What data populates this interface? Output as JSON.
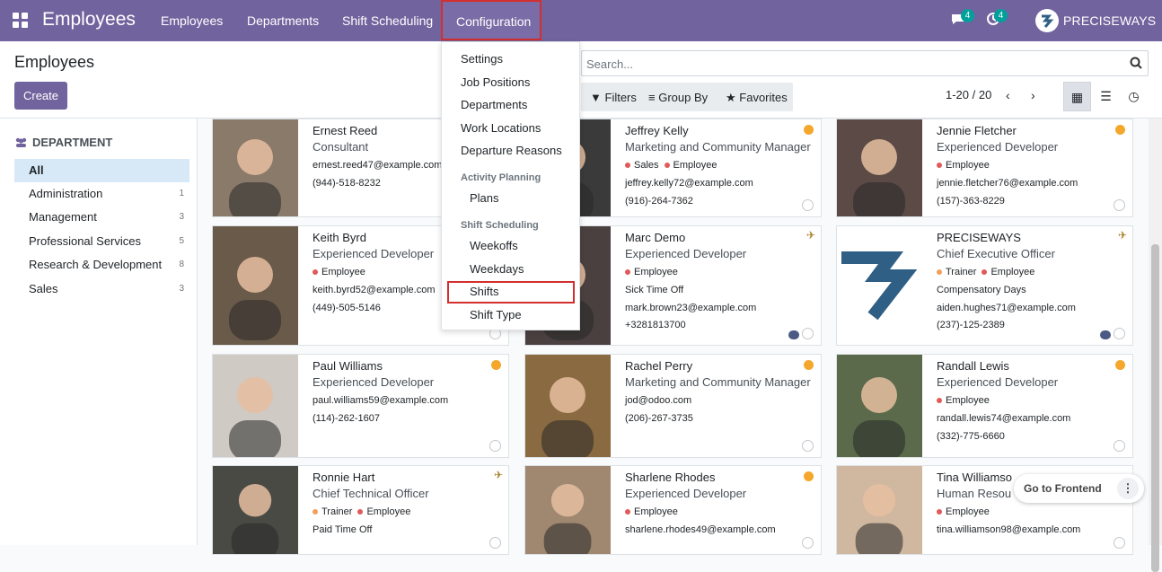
{
  "navbar": {
    "app_title": "Employees",
    "menu": [
      "Employees",
      "Departments",
      "Shift Scheduling"
    ],
    "active_menu": "Configuration",
    "messages_count": "4",
    "activities_count": "4",
    "company": "PRECISEWAYS"
  },
  "control_panel": {
    "breadcrumb": "Employees",
    "create_label": "Create",
    "search_placeholder": "Search...",
    "filters_label": "Filters",
    "group_by_label": "Group By",
    "favorites_label": "Favorites",
    "pager": "1-20 / 20"
  },
  "sidebar": {
    "heading": "DEPARTMENT",
    "items": [
      {
        "label": "All",
        "count": ""
      },
      {
        "label": "Administration",
        "count": "1"
      },
      {
        "label": "Management",
        "count": "3"
      },
      {
        "label": "Professional Services",
        "count": "5"
      },
      {
        "label": "Research & Development",
        "count": "8"
      },
      {
        "label": "Sales",
        "count": "3"
      }
    ]
  },
  "dropdown": {
    "items": [
      "Settings",
      "Job Positions",
      "Departments",
      "Work Locations",
      "Departure Reasons"
    ],
    "section1": "Activity Planning",
    "section1_items": [
      "Plans"
    ],
    "section2": "Shift Scheduling",
    "section2_items": [
      "Weekoffs",
      "Weekdays",
      "Shifts",
      "Shift Type"
    ]
  },
  "cards": [
    {
      "name": "Ernest Reed",
      "job": "Consultant",
      "tags": [],
      "lines": [
        "ernest.reed47@example.com",
        "(944)-518-8232",
        ""
      ]
    },
    {
      "name": "Jeffrey Kelly",
      "job": "Marketing and Community Manager",
      "tags": [
        "Sales",
        "Employee"
      ],
      "lines": [
        "jeffrey.kelly72@example.com",
        "(916)-264-7362",
        ""
      ]
    },
    {
      "name": "Jennie Fletcher",
      "job": "Experienced Developer",
      "tags": [
        "Employee"
      ],
      "lines": [
        "jennie.fletcher76@example.com",
        "(157)-363-8229",
        ""
      ]
    },
    {
      "name": "Keith Byrd",
      "job": "Experienced Developer",
      "tags": [
        "Employee"
      ],
      "lines": [
        "keith.byrd52@example.com",
        "(449)-505-5146",
        ""
      ]
    },
    {
      "name": "Marc Demo",
      "job": "Experienced Developer",
      "tags": [
        "Employee"
      ],
      "lines": [
        "Sick Time Off",
        "mark.brown23@example.com",
        "+3281813700"
      ]
    },
    {
      "name": "PRECISEWAYS",
      "job": "Chief Executive Officer",
      "tags": [
        "Trainer",
        "Employee"
      ],
      "lines": [
        "Compensatory Days",
        "aiden.hughes71@example.com",
        "(237)-125-2389"
      ]
    },
    {
      "name": "Paul Williams",
      "job": "Experienced Developer",
      "tags": [],
      "lines": [
        "paul.williams59@example.com",
        "(114)-262-1607",
        ""
      ]
    },
    {
      "name": "Rachel Perry",
      "job": "Marketing and Community Manager",
      "tags": [],
      "lines": [
        "jod@odoo.com",
        "(206)-267-3735",
        ""
      ]
    },
    {
      "name": "Randall Lewis",
      "job": "Experienced Developer",
      "tags": [
        "Employee"
      ],
      "lines": [
        "randall.lewis74@example.com",
        "(332)-775-6660",
        ""
      ]
    },
    {
      "name": "Ronnie Hart",
      "job": "Chief Technical Officer",
      "tags": [
        "Trainer",
        "Employee"
      ],
      "lines": [
        "Paid Time Off",
        "",
        ""
      ]
    },
    {
      "name": "Sharlene Rhodes",
      "job": "Experienced Developer",
      "tags": [
        "Employee"
      ],
      "lines": [
        "sharlene.rhodes49@example.com",
        "",
        ""
      ]
    },
    {
      "name": "Tina Williamso",
      "job": "Human Resou",
      "tags": [
        "Employee"
      ],
      "lines": [
        "tina.williamson98@example.com",
        "",
        ""
      ]
    }
  ],
  "frontend_button": "Go to Frontend",
  "colors": {
    "brand": "#71639e",
    "highlight": "#d32f2f",
    "status_away": "#f4a72b"
  }
}
